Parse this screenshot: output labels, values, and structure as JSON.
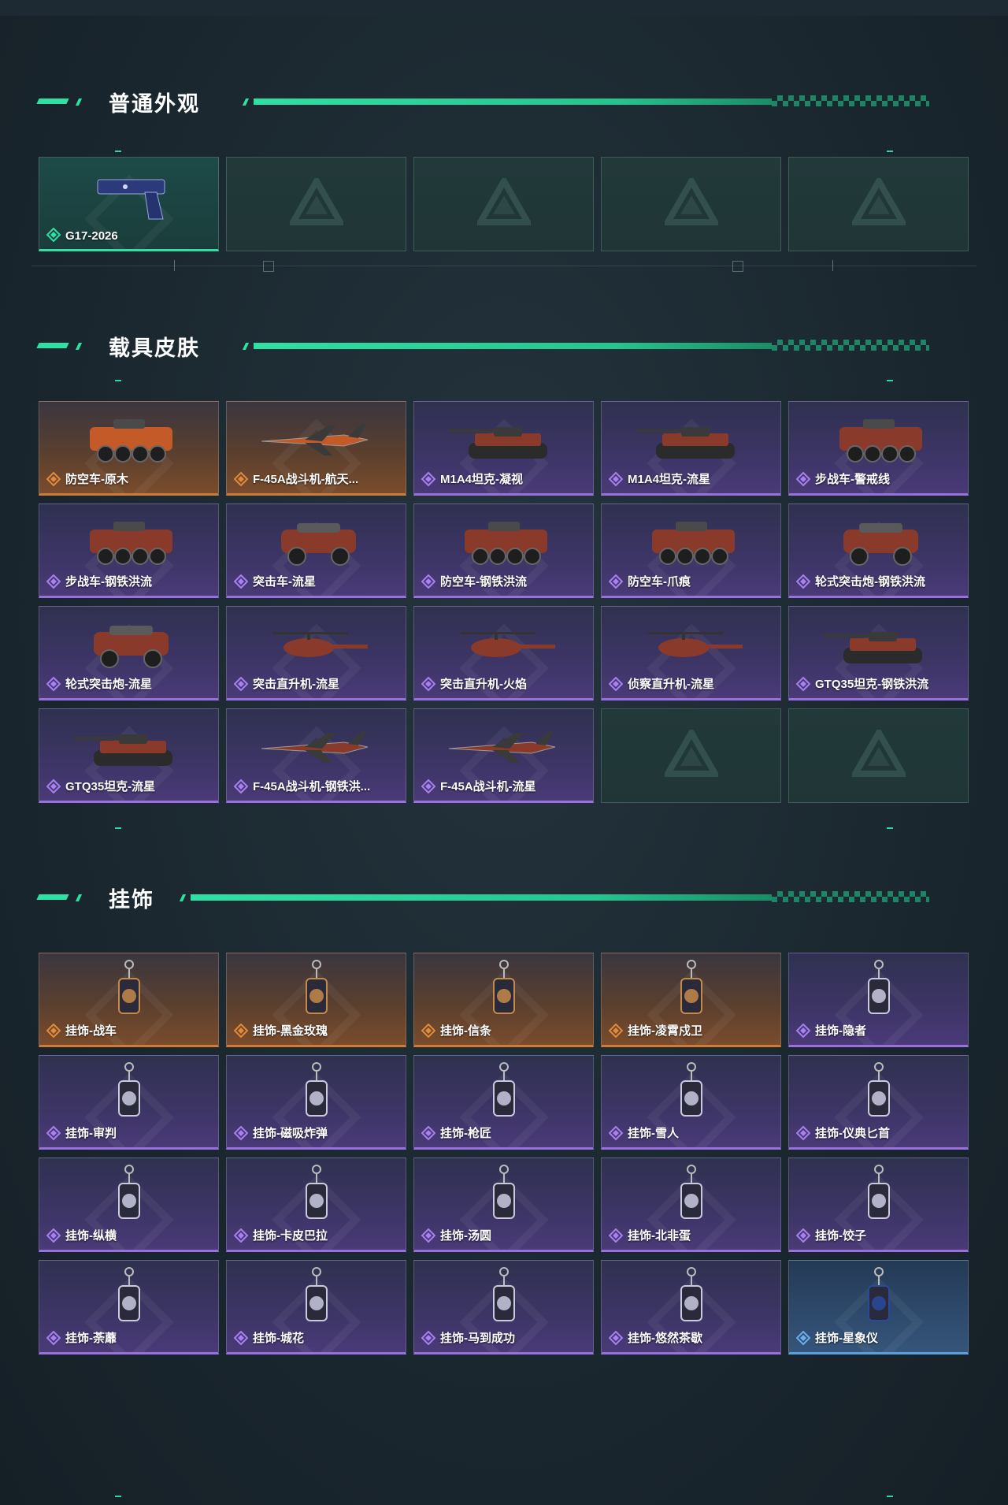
{
  "sections": [
    {
      "title": "普通外观",
      "items": [
        {
          "label": "G17-2026",
          "rarity": "teal",
          "art": "pistol-icon"
        },
        {
          "label": "",
          "rarity": "empty",
          "art": "placeholder-logo-icon"
        },
        {
          "label": "",
          "rarity": "empty",
          "art": "placeholder-logo-icon"
        },
        {
          "label": "",
          "rarity": "empty",
          "art": "placeholder-logo-icon"
        },
        {
          "label": "",
          "rarity": "empty",
          "art": "placeholder-logo-icon"
        }
      ]
    },
    {
      "title": "载具皮肤",
      "items": [
        {
          "label": "防空车-原木",
          "rarity": "orange",
          "art": "armored-vehicle-icon"
        },
        {
          "label": "F-45A战斗机-航天...",
          "rarity": "orange",
          "art": "fighter-jet-icon"
        },
        {
          "label": "M1A4坦克-凝视",
          "rarity": "purple",
          "art": "tank-icon"
        },
        {
          "label": "M1A4坦克-流星",
          "rarity": "purple",
          "art": "tank-icon"
        },
        {
          "label": "步战车-警戒线",
          "rarity": "purple",
          "art": "armored-vehicle-icon"
        },
        {
          "label": "步战车-钢铁洪流",
          "rarity": "purple",
          "art": "armored-vehicle-icon"
        },
        {
          "label": "突击车-流星",
          "rarity": "purple",
          "art": "assault-car-icon"
        },
        {
          "label": "防空车-钢铁洪流",
          "rarity": "purple",
          "art": "armored-vehicle-icon"
        },
        {
          "label": "防空车-爪痕",
          "rarity": "purple",
          "art": "armored-vehicle-icon"
        },
        {
          "label": "轮式突击炮-钢铁洪流",
          "rarity": "purple",
          "art": "assault-car-icon"
        },
        {
          "label": "轮式突击炮-流星",
          "rarity": "purple",
          "art": "assault-car-icon"
        },
        {
          "label": "突击直升机-流星",
          "rarity": "purple",
          "art": "helicopter-icon"
        },
        {
          "label": "突击直升机-火焰",
          "rarity": "purple",
          "art": "helicopter-icon"
        },
        {
          "label": "侦察直升机-流星",
          "rarity": "purple",
          "art": "helicopter-icon"
        },
        {
          "label": "GTQ35坦克-钢铁洪流",
          "rarity": "purple",
          "art": "tank-icon"
        },
        {
          "label": "GTQ35坦克-流星",
          "rarity": "purple",
          "art": "tank-icon"
        },
        {
          "label": "F-45A战斗机-钢铁洪...",
          "rarity": "purple",
          "art": "fighter-jet-icon"
        },
        {
          "label": "F-45A战斗机-流星",
          "rarity": "purple",
          "art": "fighter-jet-icon"
        },
        {
          "label": "",
          "rarity": "empty",
          "art": "placeholder-logo-icon"
        },
        {
          "label": "",
          "rarity": "empty",
          "art": "placeholder-logo-icon"
        }
      ]
    },
    {
      "title": "挂饰",
      "items": [
        {
          "label": "挂饰-战车",
          "rarity": "orange",
          "art": "charm-icon"
        },
        {
          "label": "挂饰-黑金玫瑰",
          "rarity": "orange",
          "art": "charm-icon"
        },
        {
          "label": "挂饰-信条",
          "rarity": "orange",
          "art": "charm-icon"
        },
        {
          "label": "挂饰-凌霄戍卫",
          "rarity": "orange",
          "art": "charm-icon"
        },
        {
          "label": "挂饰-隐者",
          "rarity": "purple",
          "art": "charm-icon"
        },
        {
          "label": "挂饰-审判",
          "rarity": "purple",
          "art": "charm-icon"
        },
        {
          "label": "挂饰-磁吸炸弹",
          "rarity": "purple",
          "art": "charm-icon"
        },
        {
          "label": "挂饰-枪匠",
          "rarity": "purple",
          "art": "charm-icon"
        },
        {
          "label": "挂饰-雪人",
          "rarity": "purple",
          "art": "charm-icon"
        },
        {
          "label": "挂饰-仪典匕首",
          "rarity": "purple",
          "art": "charm-icon"
        },
        {
          "label": "挂饰-纵横",
          "rarity": "purple",
          "art": "charm-icon"
        },
        {
          "label": "挂饰-卡皮巴拉",
          "rarity": "purple",
          "art": "charm-icon"
        },
        {
          "label": "挂饰-汤圆",
          "rarity": "purple",
          "art": "charm-icon"
        },
        {
          "label": "挂饰-北非蛋",
          "rarity": "purple",
          "art": "charm-icon"
        },
        {
          "label": "挂饰-饺子",
          "rarity": "purple",
          "art": "charm-icon"
        },
        {
          "label": "挂饰-荼蘼",
          "rarity": "purple",
          "art": "charm-icon"
        },
        {
          "label": "挂饰-城花",
          "rarity": "purple",
          "art": "charm-icon"
        },
        {
          "label": "挂饰-马到成功",
          "rarity": "purple",
          "art": "charm-icon"
        },
        {
          "label": "挂饰-悠然茶歇",
          "rarity": "purple",
          "art": "charm-icon"
        },
        {
          "label": "挂饰-星象仪",
          "rarity": "blue",
          "art": "charm-icon"
        }
      ]
    }
  ],
  "colors": {
    "accent": "#2fe0a3",
    "teal": "#2fe0a3",
    "orange": "#d07a3a",
    "purple": "#9a70e0",
    "blue": "#5aa0e0"
  }
}
